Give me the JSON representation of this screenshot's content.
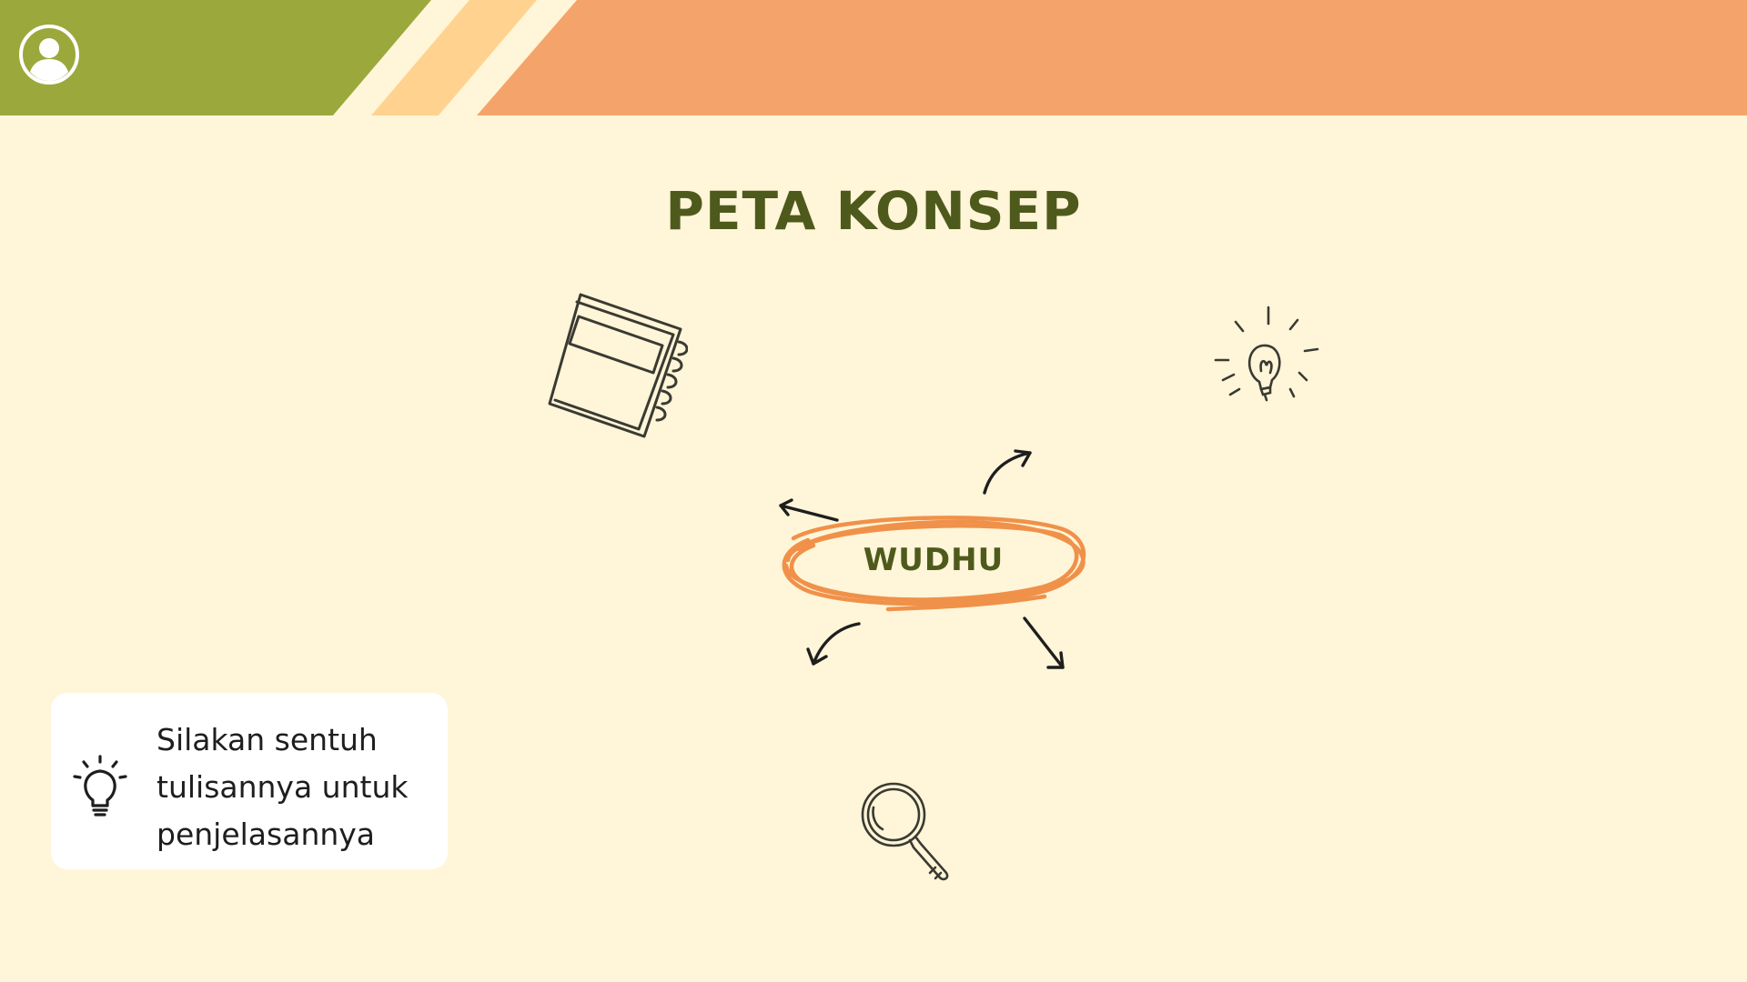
{
  "page": {
    "title": "PETA KONSEP"
  },
  "concept_map": {
    "center_label": "WUDHU",
    "arrows": [
      "arrow-up-right",
      "arrow-left",
      "arrow-down-left",
      "arrow-down-right"
    ]
  },
  "hint": {
    "text_line1": "Silakan sentuh",
    "text_line2": "tulisannya untuk",
    "text_line3": "penjelasannya",
    "icon": "lightbulb-icon"
  },
  "decorations": {
    "icons": [
      "notebook-icon",
      "lightbulb-doodle-icon",
      "magnifier-icon",
      "user-icon"
    ]
  },
  "colors": {
    "background": "#FFF5D8",
    "banner_green": "#9BA83C",
    "banner_yellow": "#FFD28F",
    "banner_orange": "#F4A46A",
    "title": "#4E5A1C",
    "scribble": "#F0914A"
  }
}
